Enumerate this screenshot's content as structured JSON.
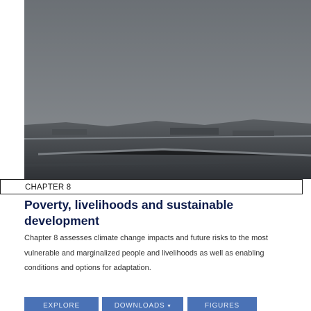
{
  "chapter": {
    "label": "CHAPTER 8",
    "title": "Poverty, livelihoods and sustainable development",
    "description": "Chapter 8 assesses climate change impacts and future risks to the most vulnerable and marginalized people and livelihoods as well as enabling conditions and options for adaptation."
  },
  "hero_image": {
    "icon": "landscape-photo"
  },
  "buttons": {
    "explore": "EXPLORE",
    "downloads": "DOWNLOADS",
    "downloads_caret": "▾",
    "figures": "FIGURES"
  },
  "colors": {
    "title": "#0d1c4b",
    "button": "#4a72b6"
  }
}
